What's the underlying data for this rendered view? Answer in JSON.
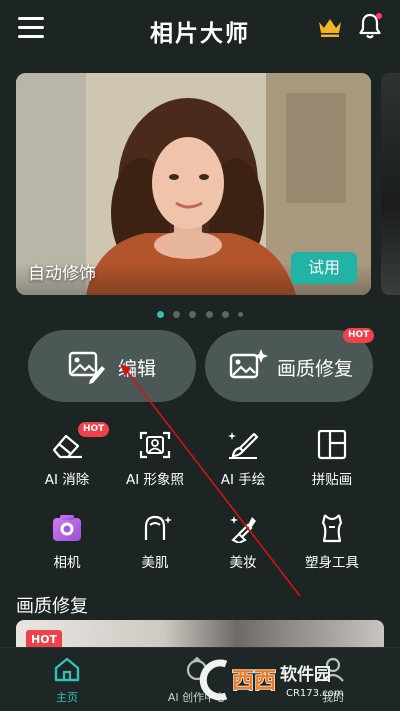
{
  "header": {
    "title": "相片大师"
  },
  "banner": {
    "label": "自动修饰",
    "try_label": "试用"
  },
  "carousel": {
    "count": 6,
    "active": 0
  },
  "actions": {
    "edit_label": "编辑",
    "quality_label": "画质修复",
    "hot_label": "HOT"
  },
  "tools": [
    {
      "label": "AI 消除",
      "hot": true
    },
    {
      "label": "AI 形象照"
    },
    {
      "label": "AI 手绘"
    },
    {
      "label": "拼贴画"
    },
    {
      "label": "相机"
    },
    {
      "label": "美肌"
    },
    {
      "label": "美妆"
    },
    {
      "label": "塑身工具"
    }
  ],
  "section": {
    "title": "画质修复",
    "hot_label": "HOT"
  },
  "nav": [
    {
      "label": "主页",
      "active": true
    },
    {
      "label": "AI 创作中心"
    },
    {
      "label": "我的"
    }
  ],
  "watermark": {
    "brand": "西西",
    "text": "软件园",
    "url": "CR173.com"
  },
  "colors": {
    "accent": "#2ec2b8",
    "hot": "#f0414b",
    "annotation": "#d01414"
  }
}
